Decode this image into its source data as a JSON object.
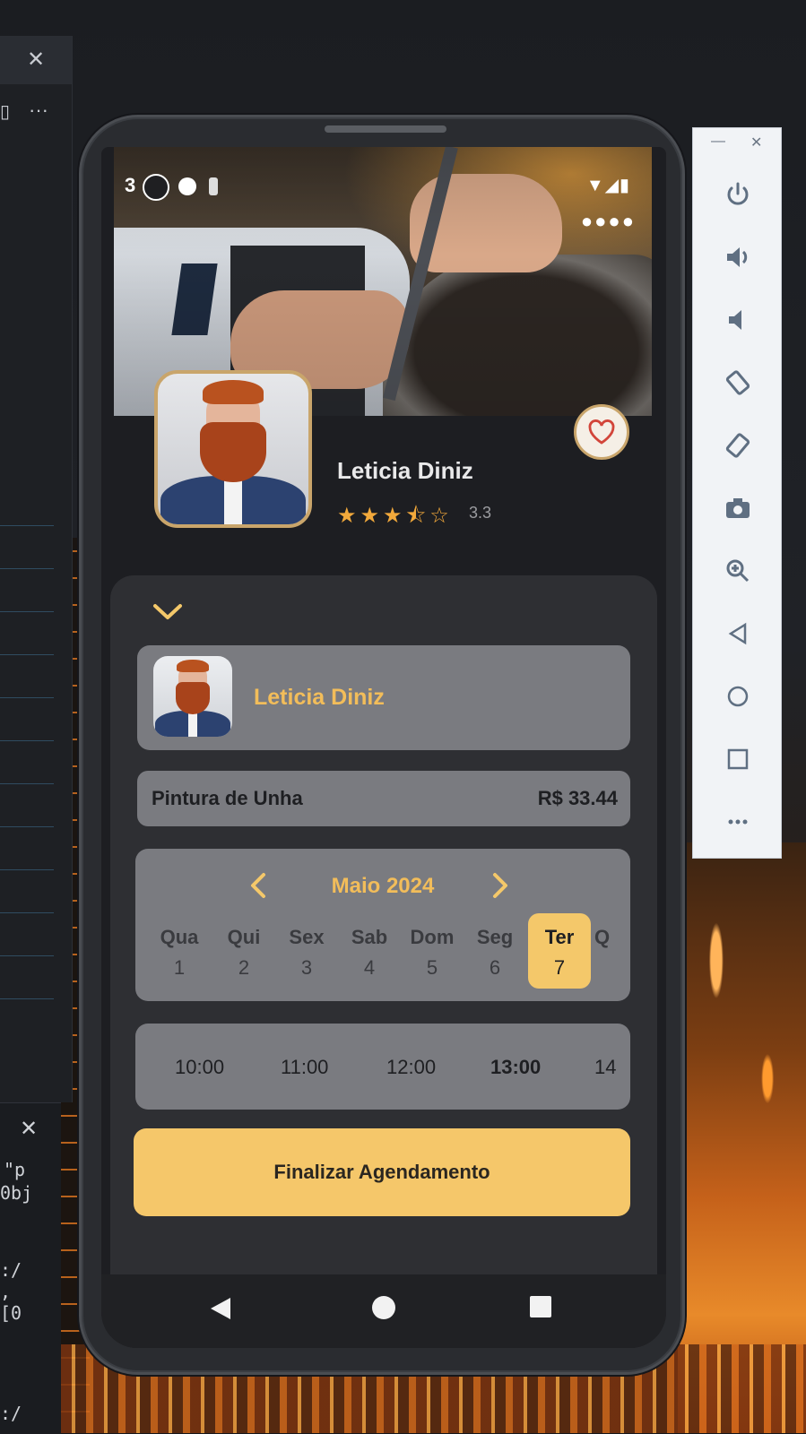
{
  "status_bar": {
    "time": "3"
  },
  "barber": {
    "name": "Leticia Diniz",
    "rating_stars": "★★★⯪☆",
    "rating_value": "3.3"
  },
  "booking": {
    "barber_name": "Leticia Diniz",
    "service": {
      "name": "Pintura de Unha",
      "price": "R$ 33.44"
    },
    "calendar": {
      "month": "Maio 2024",
      "days": [
        {
          "weekday": "Qua",
          "day": "1"
        },
        {
          "weekday": "Qui",
          "day": "2"
        },
        {
          "weekday": "Sex",
          "day": "3"
        },
        {
          "weekday": "Sab",
          "day": "4"
        },
        {
          "weekday": "Dom",
          "day": "5"
        },
        {
          "weekday": "Seg",
          "day": "6"
        },
        {
          "weekday": "Ter",
          "day": "7"
        },
        {
          "weekday": "Q",
          "day": ""
        }
      ],
      "selected_day": "7"
    },
    "times": [
      "10:00",
      "11:00",
      "12:00",
      "13:00",
      "14"
    ],
    "selected_time": "13:00",
    "finish_label": "Finalizar Agendamento"
  },
  "terminal": {
    "lines": [
      "\"p",
      "0bj",
      ":/",
      ",",
      "[0",
      ":/"
    ]
  },
  "colors": {
    "accent": "#f4c86a",
    "card_bg": "#7a7b80",
    "sheet_bg": "#2e2f33",
    "star": "#f2a93b"
  },
  "icons": {
    "favorite": "heart-icon",
    "collapse": "chevron-down-icon",
    "prev_month": "chevron-left-icon",
    "next_month": "chevron-right-icon",
    "nav_back": "triangle-back-icon",
    "nav_home": "circle-home-icon",
    "nav_recent": "square-recent-icon",
    "emulator": [
      "power-icon",
      "volume-up-icon",
      "volume-down-icon",
      "rotate-left-icon",
      "rotate-right-icon",
      "camera-icon",
      "zoom-icon",
      "back-icon",
      "home-icon",
      "overview-icon",
      "more-icon"
    ]
  }
}
